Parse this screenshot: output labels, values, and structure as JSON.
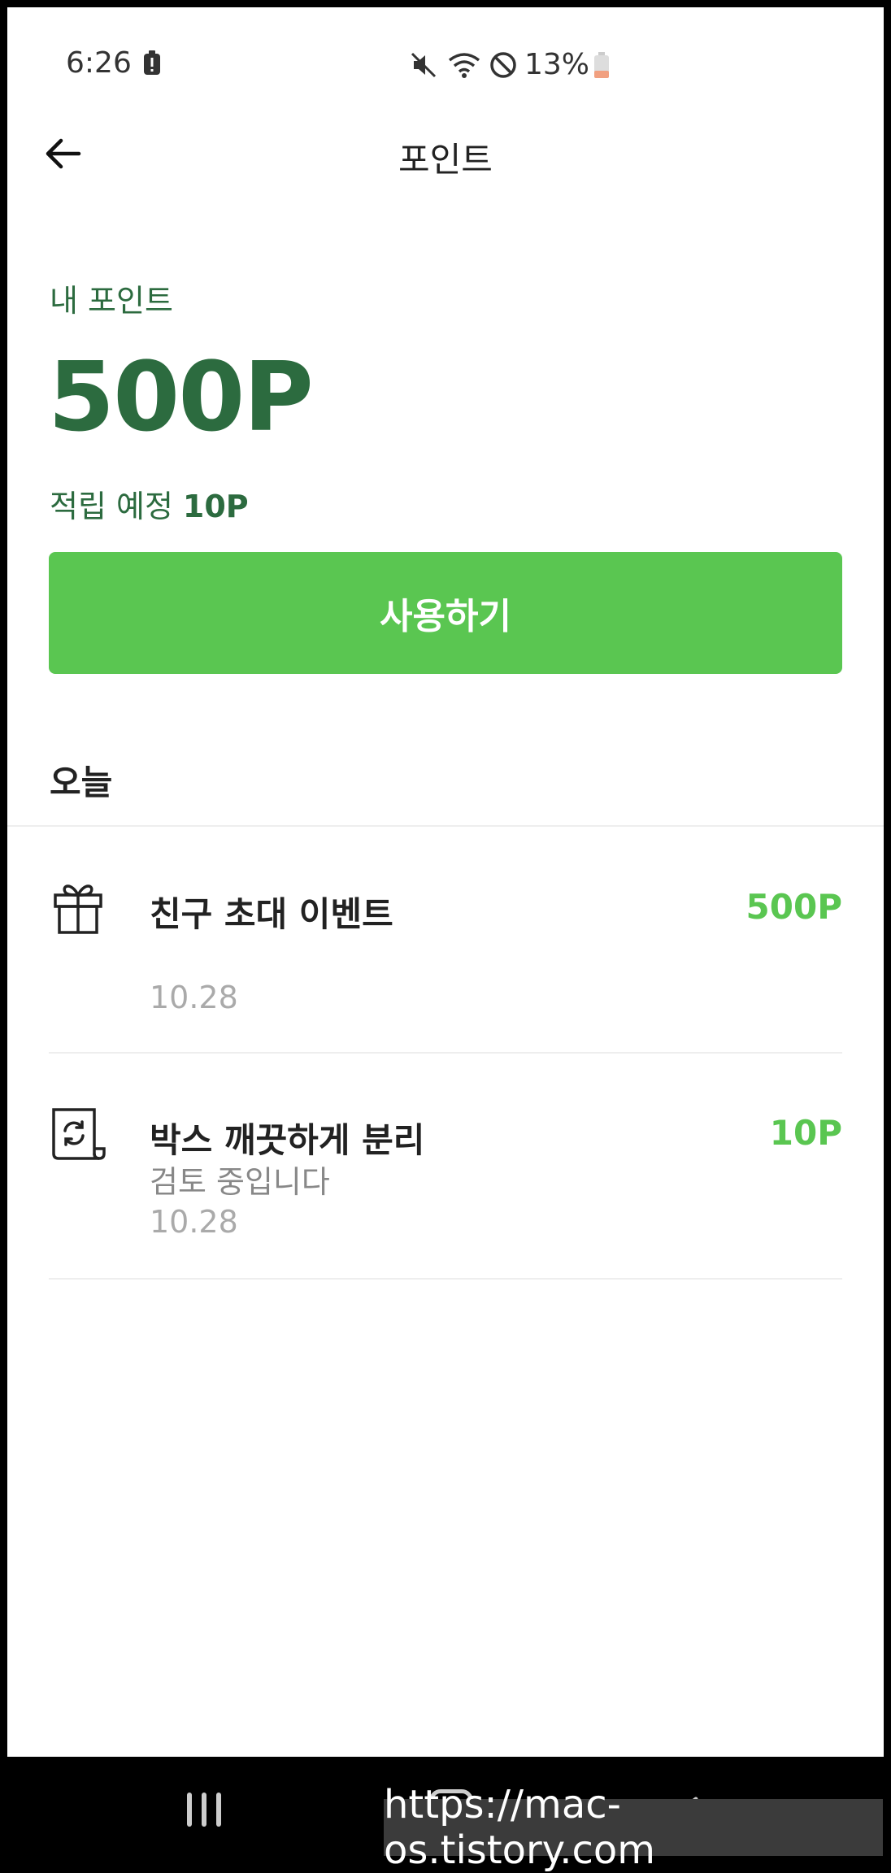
{
  "status_bar": {
    "time": "6:26",
    "battery": "13%"
  },
  "header": {
    "title": "포인트"
  },
  "summary": {
    "label": "내 포인트",
    "value": "500P",
    "pending_label": "적립 예정",
    "pending_value": "10P",
    "use_button": "사용하기"
  },
  "section": {
    "today": "오늘"
  },
  "history": [
    {
      "icon": "gift-icon",
      "title": "친구 초대 이벤트",
      "amount": "500P",
      "status": "",
      "date": "10.28"
    },
    {
      "icon": "recycle-scroll-icon",
      "title": "박스 깨끗하게 분리",
      "amount": "10P",
      "status": "검토 중입니다",
      "date": "10.28"
    }
  ],
  "watermark": "https://mac-os.tistory.com",
  "colors": {
    "accent": "#5ac651",
    "dark_green": "#2c6b3f"
  }
}
